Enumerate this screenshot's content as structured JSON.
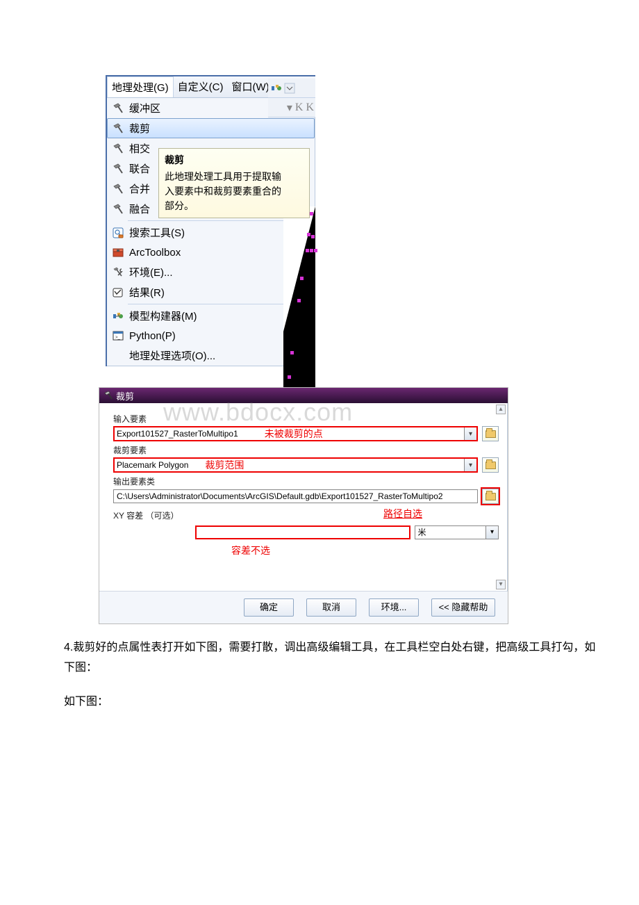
{
  "fig1": {
    "menubar": [
      "地理处理(G)",
      "自定义(C)",
      "窗口(W)"
    ],
    "items": {
      "buffer": "缓冲区",
      "clip": "裁剪",
      "intersect": "相交",
      "union": "联合",
      "merge": "合并",
      "dissolve": "融合",
      "search": "搜索工具(S)",
      "arctoolbox": "ArcToolbox",
      "env": "环境(E)...",
      "results": "结果(R)",
      "modelbuilder": "模型构建器(M)",
      "python": "Python(P)",
      "options": "地理处理选项(O)..."
    },
    "tooltip": {
      "title": "裁剪",
      "body1": "此地理处理工具用于提取输",
      "body2": "入要素中和裁剪要素重合的",
      "body3": "部分。"
    }
  },
  "fig2": {
    "title": "裁剪",
    "labels": {
      "input": "输入要素",
      "clipfeat": "裁剪要素",
      "output": "输出要素类",
      "xytol": "XY 容差 （可选）"
    },
    "values": {
      "input": "Export101527_RasterToMultipo1",
      "clipfeat": "Placemark Polygon",
      "output": "C:\\Users\\Administrator\\Documents\\ArcGIS\\Default.gdb\\Export101527_RasterToMultipo2",
      "unit": "米"
    },
    "red_notes": {
      "input": "未被裁剪的点",
      "clipfeat": "裁剪范围",
      "output": "路径自选",
      "xytol": "容差不选"
    },
    "buttons": {
      "ok": "确定",
      "cancel": "取消",
      "env": "环境...",
      "help": "<< 隐藏帮助"
    }
  },
  "text": {
    "p1": "4.裁剪好的点属性表打开如下图，需要打散，调出高级编辑工具，在工具栏空白处右键，把高级工具打勾，如下图：",
    "p2": "如下图："
  },
  "watermark": "www.bdocx.com"
}
